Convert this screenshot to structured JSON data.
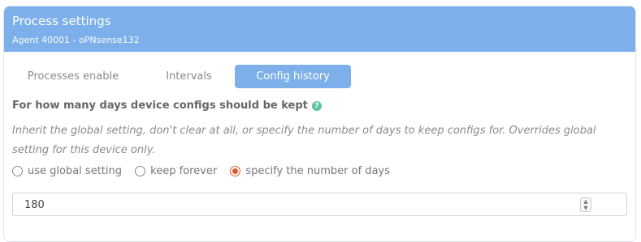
{
  "header": {
    "title": "Process settings",
    "subtitle": "Agent 40001 - oPNsense132"
  },
  "tabs": [
    {
      "label": "Processes enable",
      "active": false
    },
    {
      "label": "Intervals",
      "active": false
    },
    {
      "label": "Config history",
      "active": true
    }
  ],
  "setting": {
    "question": "For how many days device configs should be kept",
    "help_icon": "question-icon",
    "description": "Inherit the global setting, don't clear at all, or specify the number of days to keep configs for. Overrides global setting for this device only.",
    "options": [
      {
        "label": "use global setting",
        "checked": false
      },
      {
        "label": "keep forever",
        "checked": false
      },
      {
        "label": "specify the number of days",
        "checked": true
      }
    ],
    "days_value": "180"
  },
  "colors": {
    "header_bg": "#7db0ea",
    "active_tab": "#7db0ea",
    "radio_checked": "#e05a2b",
    "help_icon": "#5cc59a"
  }
}
